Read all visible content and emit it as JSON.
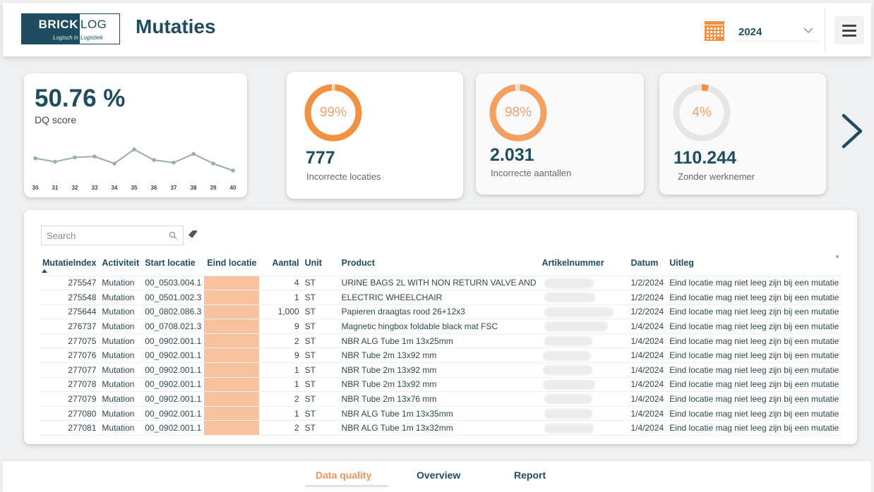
{
  "header": {
    "logo": {
      "brick": "BRICK",
      "log": "LOG",
      "tagline_left": "Logisch in",
      "tagline_right": "Logistiek"
    },
    "title": "Mutaties",
    "year_filter": {
      "icon": "calendar-icon",
      "selected": "2024"
    },
    "menu_icon": "hamburger-menu-icon"
  },
  "dq_card": {
    "value": "50.76 %",
    "label": "DQ score",
    "chart_data": {
      "type": "line",
      "x": [
        "30",
        "31",
        "32",
        "33",
        "34",
        "35",
        "36",
        "37",
        "38",
        "39",
        "40"
      ],
      "values": [
        52,
        48,
        53,
        54,
        46,
        62,
        50,
        47,
        57,
        46,
        38
      ],
      "title": "",
      "xlabel": "",
      "ylabel": "",
      "ylim": [
        30,
        70
      ],
      "grid": false,
      "color": "#9aaeb0"
    }
  },
  "kpis": [
    {
      "percent": 99,
      "percent_label": "99%",
      "value": "777",
      "label": "Incorrecte locaties",
      "color": "#f39140",
      "track": "#f39140"
    },
    {
      "percent": 98,
      "percent_label": "98%",
      "value": "2.031",
      "label": "Incorrecte aantallen",
      "color": "#f5a060",
      "track": "#f5a060"
    },
    {
      "percent": 4,
      "percent_label": "4%",
      "value": "110.244",
      "label": "Zonder werknemer",
      "color": "#f39140",
      "track": "#e6e6e6"
    }
  ],
  "next_icon": "chevron-right-icon",
  "table": {
    "search_placeholder": "Search",
    "columns": [
      "MutatieIndex",
      "Activiteit",
      "Start locatie",
      "Eind locatie",
      "Aantal",
      "Unit",
      "Product",
      "Artikelnummer",
      "Datum",
      "Uitleg"
    ],
    "sort_column": "MutatieIndex",
    "sort_direction": "ascending",
    "highlight_color": "#f9c29f",
    "rows": [
      {
        "index": "275547",
        "activiteit": "Mutation",
        "start": "00_0503.004.1",
        "eind": "",
        "aantal": "4",
        "unit": "ST",
        "product": "URINE BAGS 2L WITH NON RETURN VALVE AND",
        "artikel": "",
        "datum": "1/2/2024",
        "uitleg": "Eind locatie mag niet leeg zijn bij een mutatie"
      },
      {
        "index": "275548",
        "activiteit": "Mutation",
        "start": "00_0501.002.3",
        "eind": "",
        "aantal": "1",
        "unit": "ST",
        "product": "ELECTRIC WHEELCHAIR",
        "artikel": "",
        "datum": "1/2/2024",
        "uitleg": "Eind locatie mag niet leeg zijn bij een mutatie"
      },
      {
        "index": "275644",
        "activiteit": "Mutation",
        "start": "00_0802.086.3",
        "eind": "",
        "aantal": "1,000",
        "unit": "ST",
        "product": "Papieren draagtas rood 26+12x3",
        "artikel": "",
        "datum": "1/2/2024",
        "uitleg": "Eind locatie mag niet leeg zijn bij een mutatie"
      },
      {
        "index": "276737",
        "activiteit": "Mutation",
        "start": "00_0708.021.3",
        "eind": "",
        "aantal": "9",
        "unit": "ST",
        "product": "Magnetic hingbox foldable black mat FSC",
        "artikel": "",
        "datum": "1/4/2024",
        "uitleg": "Eind locatie mag niet leeg zijn bij een mutatie"
      },
      {
        "index": "277075",
        "activiteit": "Mutation",
        "start": "00_0902.001.1",
        "eind": "",
        "aantal": "2",
        "unit": "ST",
        "product": "NBR ALG Tube 1m 13x25mm",
        "artikel": "",
        "datum": "1/4/2024",
        "uitleg": "Eind locatie mag niet leeg zijn bij een mutatie"
      },
      {
        "index": "277076",
        "activiteit": "Mutation",
        "start": "00_0902.001.1",
        "eind": "",
        "aantal": "9",
        "unit": "ST",
        "product": "NBR Tube 2m 13x92 mm",
        "artikel": "",
        "datum": "1/4/2024",
        "uitleg": "Eind locatie mag niet leeg zijn bij een mutatie"
      },
      {
        "index": "277077",
        "activiteit": "Mutation",
        "start": "00_0902.001.1",
        "eind": "",
        "aantal": "1",
        "unit": "ST",
        "product": "NBR Tube 2m 13x92 mm",
        "artikel": "",
        "datum": "1/4/2024",
        "uitleg": "Eind locatie mag niet leeg zijn bij een mutatie"
      },
      {
        "index": "277078",
        "activiteit": "Mutation",
        "start": "00_0902.001.1",
        "eind": "",
        "aantal": "1",
        "unit": "ST",
        "product": "NBR Tube 2m 13x92 mm",
        "artikel": "",
        "datum": "1/4/2024",
        "uitleg": "Eind locatie mag niet leeg zijn bij een mutatie"
      },
      {
        "index": "277079",
        "activiteit": "Mutation",
        "start": "00_0902.001.1",
        "eind": "",
        "aantal": "2",
        "unit": "ST",
        "product": "NBR Tube 2m 13x76 mm",
        "artikel": "",
        "datum": "1/4/2024",
        "uitleg": "Eind locatie mag niet leeg zijn bij een mutatie"
      },
      {
        "index": "277080",
        "activiteit": "Mutation",
        "start": "00_0902.001.1",
        "eind": "",
        "aantal": "1",
        "unit": "ST",
        "product": "NBR ALG Tube 1m 13x35mm",
        "artikel": "",
        "datum": "1/4/2024",
        "uitleg": "Eind locatie mag niet leeg zijn bij een mutatie"
      },
      {
        "index": "277081",
        "activiteit": "Mutation",
        "start": "00_0902.001.1",
        "eind": "",
        "aantal": "2",
        "unit": "ST",
        "product": "NBR ALG Tube 1m 13x32mm",
        "artikel": "",
        "datum": "1/4/2024",
        "uitleg": "Eind locatie mag niet leeg zijn bij een mutatie"
      }
    ]
  },
  "bottom_nav": {
    "tabs": [
      {
        "label": "Data quality",
        "active": true
      },
      {
        "label": "Overview",
        "active": false
      },
      {
        "label": "Report",
        "active": false
      }
    ]
  }
}
